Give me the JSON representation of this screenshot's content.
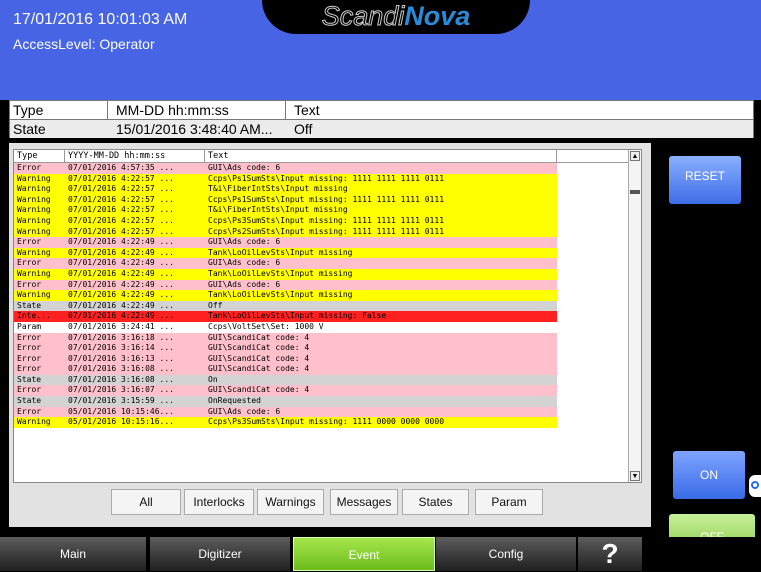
{
  "header": {
    "datetime": "17/01/2016 10:01:03 AM",
    "access_level": "AccessLevel: Operator",
    "logo_part1": "Scandi",
    "logo_part2": "Nova"
  },
  "summary": {
    "col_type": "Type",
    "col_time": "MM-DD hh:mm:ss",
    "col_text": "Text",
    "row_type": "State",
    "row_time": "15/01/2016 3:48:40 AM...",
    "row_text": "Off"
  },
  "log": {
    "headers": [
      "Type",
      "YYYY-MM-DD hh:mm:ss",
      "Text"
    ],
    "rows": [
      {
        "type": "Error",
        "time": "07/01/2016 4:57:35 ...",
        "text": "GUI\\Ads code: 6",
        "color": "#ffc0cb"
      },
      {
        "type": "Warning",
        "time": "07/01/2016 4:22:57 ...",
        "text": "Ccps\\Ps1SumSts\\Input missing: 1111 1111 1111 0111",
        "color": "#ffff00"
      },
      {
        "type": "Warning",
        "time": "07/01/2016 4:22:57 ...",
        "text": "T&i\\FiberIntSts\\Input missing",
        "color": "#ffff00"
      },
      {
        "type": "Warning",
        "time": "07/01/2016 4:22:57 ...",
        "text": "Ccps\\Ps1SumSts\\Input missing: 1111 1111 1111 0111",
        "color": "#ffff00"
      },
      {
        "type": "Warning",
        "time": "07/01/2016 4:22:57 ...",
        "text": "T&i\\FiberIntSts\\Input missing",
        "color": "#ffff00"
      },
      {
        "type": "Warning",
        "time": "07/01/2016 4:22:57 ...",
        "text": "Ccps\\Ps3SumSts\\Input missing: 1111 1111 1111 0111",
        "color": "#ffff00"
      },
      {
        "type": "Warning",
        "time": "07/01/2016 4:22:57 ...",
        "text": "Ccps\\Ps2SumSts\\Input missing: 1111 1111 1111 0111",
        "color": "#ffff00"
      },
      {
        "type": "Error",
        "time": "07/01/2016 4:22:49 ...",
        "text": "GUI\\Ads code: 6",
        "color": "#ffc0cb"
      },
      {
        "type": "Warning",
        "time": "07/01/2016 4:22:49 ...",
        "text": "Tank\\LoOilLevSts\\Input missing",
        "color": "#ffff00"
      },
      {
        "type": "Error",
        "time": "07/01/2016 4:22:49 ...",
        "text": "GUI\\Ads code: 6",
        "color": "#ffc0cb"
      },
      {
        "type": "Warning",
        "time": "07/01/2016 4:22:49 ...",
        "text": "Tank\\LoOilLevSts\\Input missing",
        "color": "#ffff00"
      },
      {
        "type": "Error",
        "time": "07/01/2016 4:22:49 ...",
        "text": "GUI\\Ads code: 6",
        "color": "#ffc0cb"
      },
      {
        "type": "Warning",
        "time": "07/01/2016 4:22:49 ...",
        "text": "Tank\\LoOilLevSts\\Input missing",
        "color": "#ffff00"
      },
      {
        "type": "State",
        "time": "07/01/2016 4:22:49 ...",
        "text": "Off",
        "color": "#d3d3d3"
      },
      {
        "type": "Inte...",
        "time": "07/01/2016 4:22:49 ...",
        "text": "Tank\\LoOilLevSts\\Input missing: False",
        "color": "#ff2020"
      },
      {
        "type": "Param",
        "time": "07/01/2016 3:24:41 ...",
        "text": "Ccps\\VoltSet\\Set: 1000 V",
        "color": "#ffffff"
      },
      {
        "type": "Error",
        "time": "07/01/2016 3:16:18 ...",
        "text": "GUI\\ScandiCat code: 4",
        "color": "#ffc0cb"
      },
      {
        "type": "Error",
        "time": "07/01/2016 3:16:14 ...",
        "text": "GUI\\ScandiCat code: 4",
        "color": "#ffc0cb"
      },
      {
        "type": "Error",
        "time": "07/01/2016 3:16:13 ...",
        "text": "GUI\\ScandiCat code: 4",
        "color": "#ffc0cb"
      },
      {
        "type": "Error",
        "time": "07/01/2016 3:16:08 ...",
        "text": "GUI\\ScandiCat code: 4",
        "color": "#ffc0cb"
      },
      {
        "type": "State",
        "time": "07/01/2016 3:16:08 ...",
        "text": "On",
        "color": "#d3d3d3"
      },
      {
        "type": "Error",
        "time": "07/01/2016 3:16:07 ...",
        "text": "GUI\\ScandiCat code: 4",
        "color": "#ffc0cb"
      },
      {
        "type": "State",
        "time": "07/01/2016 3:15:59 ...",
        "text": "OnRequested",
        "color": "#d3d3d3"
      },
      {
        "type": "Error",
        "time": "05/01/2016 10:15:46...",
        "text": "GUI\\Ads code: 6",
        "color": "#ffc0cb"
      },
      {
        "type": "Warning",
        "time": "05/01/2016 10:15:16...",
        "text": "Ccps\\Ps3SumSts\\Input missing: 1111 0000 0000 0000",
        "color": "#ffff00"
      }
    ]
  },
  "filters": {
    "all": "All",
    "interlocks": "Interlocks",
    "warnings": "Warnings",
    "messages": "Messages",
    "states": "States",
    "param": "Param"
  },
  "side": {
    "reset": "RESET",
    "on": "ON",
    "off": "OFF"
  },
  "nav": {
    "main": "Main",
    "digitizer": "Digitizer",
    "event": "Event",
    "config": "Config",
    "help": "?"
  },
  "colors": {
    "header_blue": "#4664e4",
    "error": "#ffc0cb",
    "warning": "#ffff00",
    "state": "#d3d3d3",
    "interlock": "#ff2020",
    "active_tab": "#8ad63a"
  }
}
